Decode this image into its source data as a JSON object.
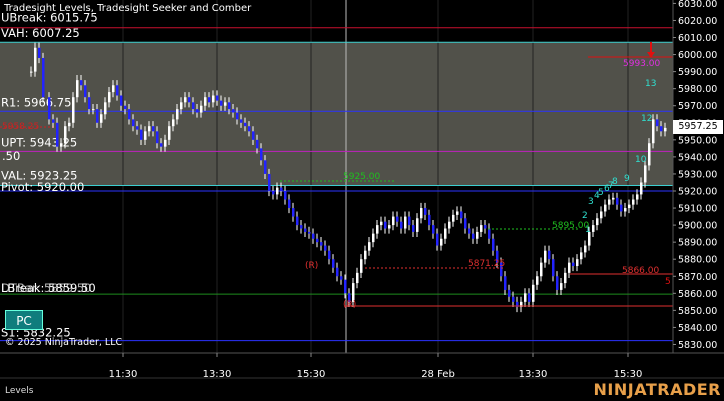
{
  "header": {
    "title": "Tradesight Levels, Tradesight Seeker and Comber"
  },
  "footer": {
    "copyright": "© 2025 NinjaTrader, LLC",
    "tab_label": "Levels",
    "brand": "NINJATRADER"
  },
  "current_price": "5957.25",
  "pc_button": "PC",
  "y_axis": {
    "min": 5825,
    "max": 6032,
    "ticks": [
      "6030.00",
      "6020.00",
      "6010.00",
      "6000.00",
      "5990.00",
      "5980.00",
      "5970.00",
      "5960.00",
      "5950.00",
      "5940.00",
      "5930.00",
      "5920.00",
      "5910.00",
      "5900.00",
      "5890.00",
      "5880.00",
      "5870.00",
      "5860.00",
      "5850.00",
      "5840.00",
      "5830.00"
    ]
  },
  "x_axis": {
    "labels": [
      "11:30",
      "13:30",
      "15:30",
      "28 Feb",
      "13:30",
      "15:30"
    ]
  },
  "levels": [
    {
      "label": "UBreak: 6015.75",
      "price": 6015.75,
      "color": "#c8102e"
    },
    {
      "label": "VAH: 6007.25",
      "price": 6007.25,
      "color": "#3ccfd0"
    },
    {
      "label": "R1: 5966.75",
      "price": 5966.75,
      "color": "#2b33ff"
    },
    {
      "label": "UPT: 5943.25",
      "price": 5943.25,
      "color": "#c020c0"
    },
    {
      "label": "VAL: 5923.25",
      "price": 5923.25,
      "color": "#3ccfd0"
    },
    {
      "label": "Pivot: 5920.00",
      "price": 5920.0,
      "color": "#2b33ff"
    },
    {
      "label": "LBreak: 5859.50",
      "price": 5859.5,
      "color": "#1e8c1e"
    },
    {
      "label": "S1: 5832.25",
      "price": 5832.25,
      "color": "#2b33ff"
    }
  ],
  "overlap_labels": {
    "lbreak_extra": "DTBar: 5859.50",
    "s1_cut": "S",
    "s1_value": "2.25",
    "left_half": ".50",
    "r1_red": "5958.25"
  },
  "annotations": {
    "sell_target": "5993.00",
    "buy_level_a": "5895.00",
    "buy_level_b": "5925.00",
    "stop_a": "5871.25",
    "stop_b": "5866.00",
    "r_label": "(R)",
    "count_13": "13",
    "count_12": "12",
    "count_10": "10",
    "count_9": "9",
    "count_5": "5",
    "seq": [
      "1",
      "2",
      "3",
      "4",
      "5",
      "6",
      "7",
      "8"
    ]
  }
}
